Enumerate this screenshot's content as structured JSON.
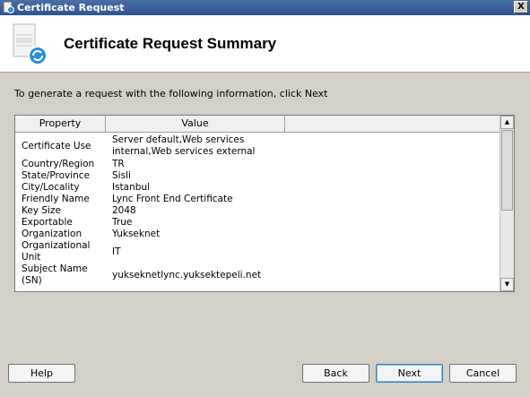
{
  "window": {
    "title": "Certificate Request",
    "close_glyph": "X"
  },
  "header": {
    "title": "Certificate Request Summary",
    "icon": "certificate-wizard-icon"
  },
  "instruction": "To generate a request with the following information, click Next",
  "grid": {
    "columns": [
      "Property",
      "Value"
    ],
    "rows": [
      {
        "property": "Certificate Use",
        "value": "Server default,Web services internal,Web services external"
      },
      {
        "property": "Country/Region",
        "value": "TR"
      },
      {
        "property": "State/Province",
        "value": "Sisli"
      },
      {
        "property": "City/Locality",
        "value": "Istanbul"
      },
      {
        "property": "Friendly Name",
        "value": "Lync Front End Certificate"
      },
      {
        "property": "Key Size",
        "value": "2048"
      },
      {
        "property": "Exportable",
        "value": "True"
      },
      {
        "property": "Organization",
        "value": "Yukseknet"
      },
      {
        "property": "Organizational Unit",
        "value": "IT"
      },
      {
        "property": "Subject Name (SN)",
        "value": "yukseknetlync.yuksektepeli.net"
      }
    ]
  },
  "buttons": {
    "help": "Help",
    "back": "Back",
    "next": "Next",
    "cancel": "Cancel"
  },
  "colors": {
    "titlebar": "#2e5391",
    "dialog_background": "#d4d0c8",
    "header_background": "#ffffff"
  }
}
